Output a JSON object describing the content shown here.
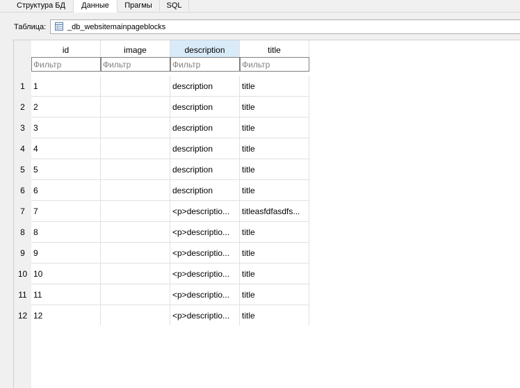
{
  "tabs": [
    {
      "label": "Структура БД"
    },
    {
      "label": "Данные"
    },
    {
      "label": "Прагмы"
    },
    {
      "label": "SQL"
    }
  ],
  "table_selector": {
    "label": "Таблица:",
    "value": "_db_websitemainpageblocks"
  },
  "grid": {
    "columns": [
      "id",
      "image",
      "description",
      "title"
    ],
    "selected_column": "description",
    "filter_placeholder": "Фильтр",
    "rows": [
      {
        "num": "1",
        "id": "1",
        "image": "",
        "description": "description",
        "title": "title"
      },
      {
        "num": "2",
        "id": "2",
        "image": "",
        "description": "description",
        "title": "title"
      },
      {
        "num": "3",
        "id": "3",
        "image": "",
        "description": "description",
        "title": "title"
      },
      {
        "num": "4",
        "id": "4",
        "image": "",
        "description": "description",
        "title": "title"
      },
      {
        "num": "5",
        "id": "5",
        "image": "",
        "description": "description",
        "title": "title"
      },
      {
        "num": "6",
        "id": "6",
        "image": "",
        "description": "description",
        "title": "title"
      },
      {
        "num": "7",
        "id": "7",
        "image": "",
        "description": "<p>descriptio...",
        "title": "titleasfdfasdfs..."
      },
      {
        "num": "8",
        "id": "8",
        "image": "",
        "description": "<p>descriptio...",
        "title": "title"
      },
      {
        "num": "9",
        "id": "9",
        "image": "",
        "description": "<p>descriptio...",
        "title": "title"
      },
      {
        "num": "10",
        "id": "10",
        "image": "",
        "description": "<p>descriptio...",
        "title": "title"
      },
      {
        "num": "11",
        "id": "11",
        "image": "",
        "description": "<p>descriptio...",
        "title": "title"
      },
      {
        "num": "12",
        "id": "12",
        "image": "",
        "description": "<p>descriptio...",
        "title": "title"
      }
    ]
  },
  "colors": {
    "background": "#f0f0f0",
    "selected_header": "#d9ebf9",
    "grid_line": "#e0e0e0"
  }
}
